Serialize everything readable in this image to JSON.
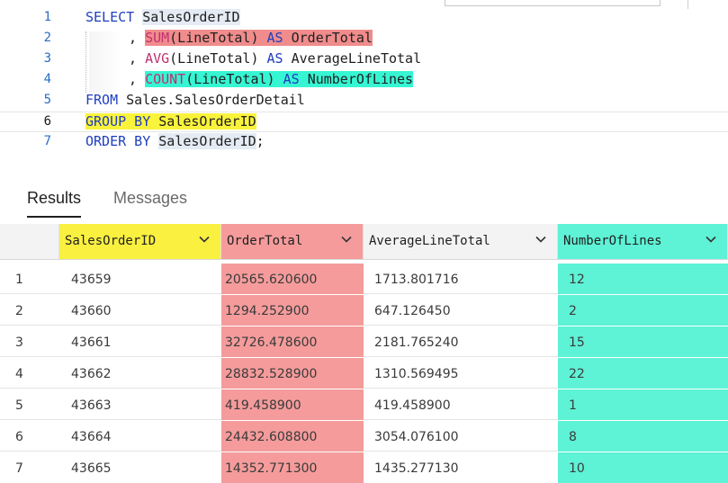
{
  "editor": {
    "lines": [
      {
        "n": "1"
      },
      {
        "n": "2"
      },
      {
        "n": "3"
      },
      {
        "n": "4"
      },
      {
        "n": "5"
      },
      {
        "n": "6"
      },
      {
        "n": "7"
      }
    ],
    "t": {
      "select": "SELECT",
      "salesorderid": "SalesOrderID",
      "comma": ",",
      "sum": "SUM",
      "linetotal_paren": "(LineTotal)",
      "as": "AS",
      "ordertotal": "OrderTotal",
      "avg": "AVG",
      "averagelinetotal": "AverageLineTotal",
      "count": "COUNT",
      "numberoflines": "NumberOfLines",
      "from": "FROM",
      "table": "Sales.SalesOrderDetail",
      "group_by": "GROUP BY",
      "order_by": "ORDER BY",
      "semicolon": ";"
    },
    "colors": {
      "keyword": "#1f3fbf",
      "function": "#c03070",
      "hl_red": "#f08c8c",
      "hl_cyan": "#36f5d3",
      "hl_yellow": "#faf33c"
    }
  },
  "results": {
    "tabs": [
      {
        "label": "Results",
        "active": true
      },
      {
        "label": "Messages",
        "active": false
      }
    ],
    "columns": [
      {
        "label": "SalesOrderID",
        "highlight": "#faf040"
      },
      {
        "label": "OrderTotal",
        "highlight": "#f59b9b"
      },
      {
        "label": "AverageLineTotal",
        "highlight": ""
      },
      {
        "label": "NumberOfLines",
        "highlight": "#5ef2d6"
      }
    ],
    "rows": [
      {
        "idx": "1",
        "id": "43659",
        "total": "20565.620600",
        "avg": "1713.801716",
        "num": "12"
      },
      {
        "idx": "2",
        "id": "43660",
        "total": "1294.252900",
        "avg": "647.126450",
        "num": "2"
      },
      {
        "idx": "3",
        "id": "43661",
        "total": "32726.478600",
        "avg": "2181.765240",
        "num": "15"
      },
      {
        "idx": "4",
        "id": "43662",
        "total": "28832.528900",
        "avg": "1310.569495",
        "num": "22"
      },
      {
        "idx": "5",
        "id": "43663",
        "total": "419.458900",
        "avg": "419.458900",
        "num": "1"
      },
      {
        "idx": "6",
        "id": "43664",
        "total": "24432.608800",
        "avg": "3054.076100",
        "num": "8"
      },
      {
        "idx": "7",
        "id": "43665",
        "total": "14352.771300",
        "avg": "1435.277130",
        "num": "10"
      }
    ],
    "icons": {
      "sort": "chevron-down-icon"
    }
  }
}
